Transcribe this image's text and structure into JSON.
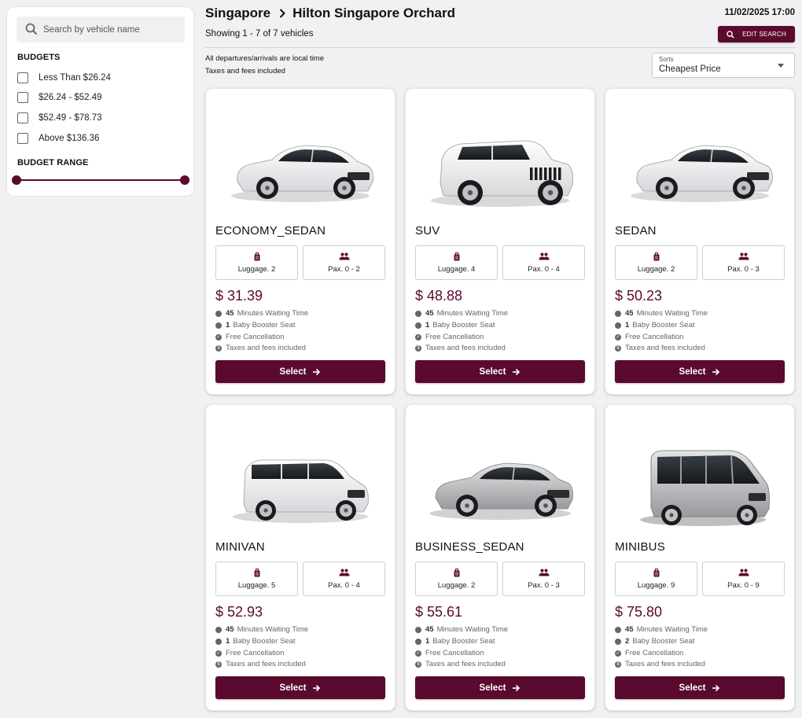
{
  "sidebar": {
    "search_placeholder": "Search by vehicle name",
    "budgets_heading": "BUDGETS",
    "budgets": [
      "Less Than $26.24",
      "$26.24 - $52.49",
      "$52.49 - $78.73",
      "Above $136.36"
    ],
    "budget_range_heading": "BUDGET RANGE"
  },
  "header": {
    "origin": "Singapore",
    "destination": "Hilton Singapore Orchard",
    "datetime": "11/02/2025 17:00",
    "showing": "Showing 1 - 7 of 7 vehicles",
    "edit_label": "EDIT SEARCH",
    "info_line1": "All departures/arrivals are local time",
    "info_line2": "Taxes and fees included",
    "sort_caption": "Sorts",
    "sort_value": "Cheapest Price"
  },
  "colors": {
    "accent": "#5a0a2f",
    "page_bg": "#f1f1f4"
  },
  "vehicles": [
    {
      "name": "ECONOMY_SEDAN",
      "luggage": "Luggage. 2",
      "pax": "Pax. 0 - 2",
      "price": "$ 31.39",
      "wait_num": "45",
      "wait_text": "Minutes Waiting Time",
      "seat_num": "1",
      "seat_text": "Baby Booster Seat",
      "cancel": "Free Cancellation",
      "taxes": "Taxes and fees included",
      "select": "Select",
      "icon": "sedan-car-image"
    },
    {
      "name": "SUV",
      "luggage": "Luggage. 4",
      "pax": "Pax. 0 - 4",
      "price": "$ 48.88",
      "wait_num": "45",
      "wait_text": "Minutes Waiting Time",
      "seat_num": "1",
      "seat_text": "Baby Booster Seat",
      "cancel": "Free Cancellation",
      "taxes": "Taxes and fees included",
      "select": "Select",
      "icon": "suv-car-image"
    },
    {
      "name": "SEDAN",
      "luggage": "Luggage. 2",
      "pax": "Pax. 0 - 3",
      "price": "$ 50.23",
      "wait_num": "45",
      "wait_text": "Minutes Waiting Time",
      "seat_num": "1",
      "seat_text": "Baby Booster Seat",
      "cancel": "Free Cancellation",
      "taxes": "Taxes and fees included",
      "select": "Select",
      "icon": "sedan-car-image"
    },
    {
      "name": "MINIVAN",
      "luggage": "Luggage. 5",
      "pax": "Pax. 0 - 4",
      "price": "$ 52.93",
      "wait_num": "45",
      "wait_text": "Minutes Waiting Time",
      "seat_num": "1",
      "seat_text": "Baby Booster Seat",
      "cancel": "Free Cancellation",
      "taxes": "Taxes and fees included",
      "select": "Select",
      "icon": "minivan-image"
    },
    {
      "name": "BUSINESS_SEDAN",
      "luggage": "Luggage. 2",
      "pax": "Pax. 0 - 3",
      "price": "$ 55.61",
      "wait_num": "45",
      "wait_text": "Minutes Waiting Time",
      "seat_num": "1",
      "seat_text": "Baby Booster Seat",
      "cancel": "Free Cancellation",
      "taxes": "Taxes and fees included",
      "select": "Select",
      "icon": "luxury-sedan-image"
    },
    {
      "name": "MINIBUS",
      "luggage": "Luggage. 9",
      "pax": "Pax. 0 - 9",
      "price": "$ 75.80",
      "wait_num": "45",
      "wait_text": "Minutes Waiting Time",
      "seat_num": "2",
      "seat_text": "Baby Booster Seat",
      "cancel": "Free Cancellation",
      "taxes": "Taxes and fees included",
      "select": "Select",
      "icon": "minibus-image"
    }
  ]
}
